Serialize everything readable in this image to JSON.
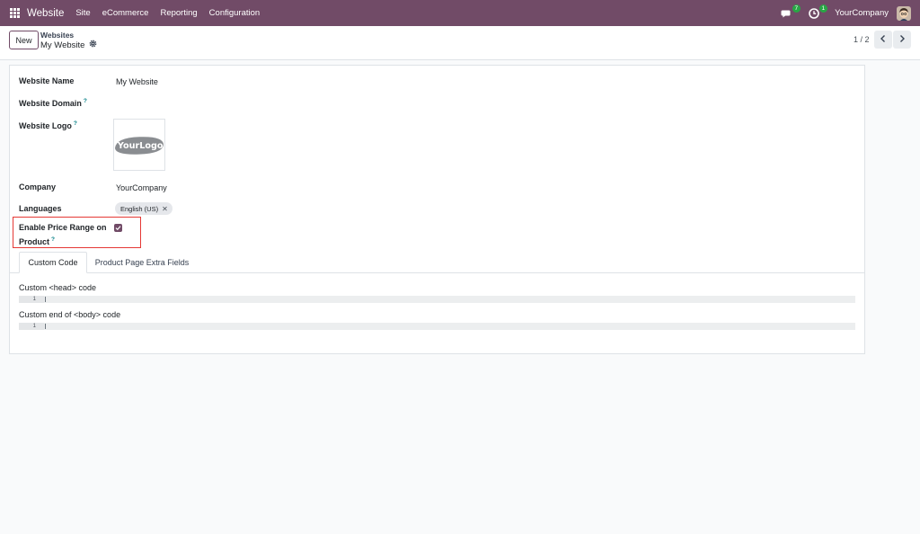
{
  "navbar": {
    "brand": "Website",
    "menu": [
      "Site",
      "eCommerce",
      "Reporting",
      "Configuration"
    ],
    "messages_badge": "7",
    "activities_badge": "1",
    "company": "YourCompany",
    "accent": "#714b67"
  },
  "control_panel": {
    "new_label": "New",
    "breadcrumb_parent": "Websites",
    "breadcrumb_current": "My Website",
    "pager": "1 / 2"
  },
  "form": {
    "website_name_label": "Website Name",
    "website_name_value": "My Website",
    "website_domain_label": "Website Domain",
    "website_logo_label": "Website Logo",
    "logo_text": "YourLogo",
    "company_label": "Company",
    "company_value": "YourCompany",
    "languages_label": "Languages",
    "language_tag": "English (US)",
    "price_range_label_line1": "Enable Price Range on",
    "price_range_label_line2": "Product",
    "price_range_checked": true,
    "help_mark": "?"
  },
  "tabs": [
    "Custom Code",
    "Product Page Extra Fields"
  ],
  "custom_code": {
    "head_label": "Custom <head> code",
    "body_label": "Custom end of <body> code",
    "line_number": "1"
  }
}
